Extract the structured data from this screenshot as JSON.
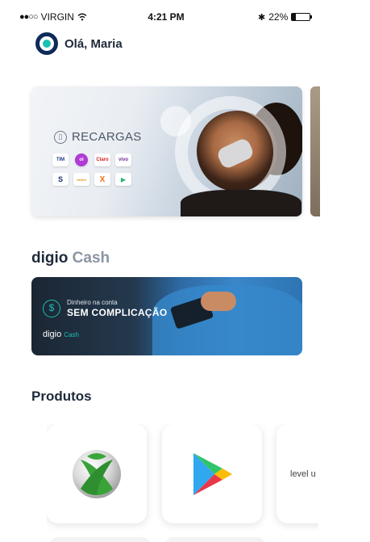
{
  "status_bar": {
    "carrier": "VIRGIN",
    "time": "4:21 PM",
    "battery_percent": "22%",
    "battery_level": 0.22
  },
  "greeting": {
    "text": "Olá, Maria"
  },
  "recargas_banner": {
    "title": "RECARGAS",
    "operators": [
      "TIM",
      "oi",
      "Claro",
      "vivo",
      "S",
      "nextel",
      "X",
      "play"
    ]
  },
  "digio_cash": {
    "title_bold": "digio",
    "title_light": "Cash",
    "banner_small": "Dinheiro na conta",
    "banner_big": "SEM COMPLICAÇÃO",
    "banner_brand": "digio",
    "banner_brand_accent": "Cash"
  },
  "produtos": {
    "title": "Produtos",
    "items": [
      {
        "name": "Xbox",
        "icon": "xbox-icon"
      },
      {
        "name": "Google Play",
        "icon": "google-play-icon"
      },
      {
        "name": "level up",
        "icon": "levelup-logo",
        "text": "level u"
      }
    ]
  },
  "colors": {
    "brand_navy": "#0e2b5a",
    "brand_teal": "#1bc0b3",
    "text_dark": "#1d2a3a",
    "text_light": "#8a96a3"
  }
}
